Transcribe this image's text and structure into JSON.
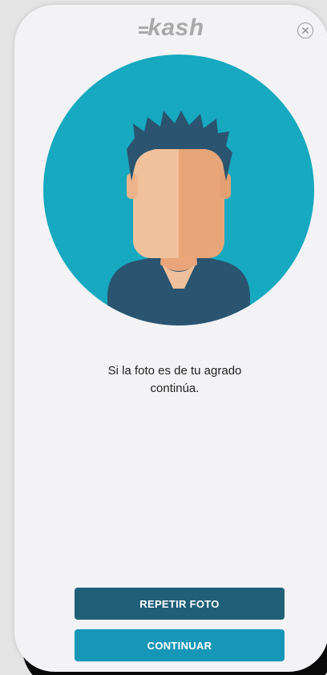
{
  "header": {
    "logo_text": "kash",
    "close_icon": "close-circle-icon"
  },
  "photo": {
    "icon": "user-avatar-icon"
  },
  "message": {
    "line1": "Si la foto es de tu agrado",
    "line2": "continúa."
  },
  "actions": {
    "repeat_label": "REPETIR FOTO",
    "continue_label": "CONTINUAR"
  },
  "colors": {
    "repeat_button": "#1f5f78",
    "continue_button": "#1697b7",
    "avatar_background": "#16a9c0",
    "logo": "#a9a9a9",
    "screen_background": "#f3f3f5"
  }
}
